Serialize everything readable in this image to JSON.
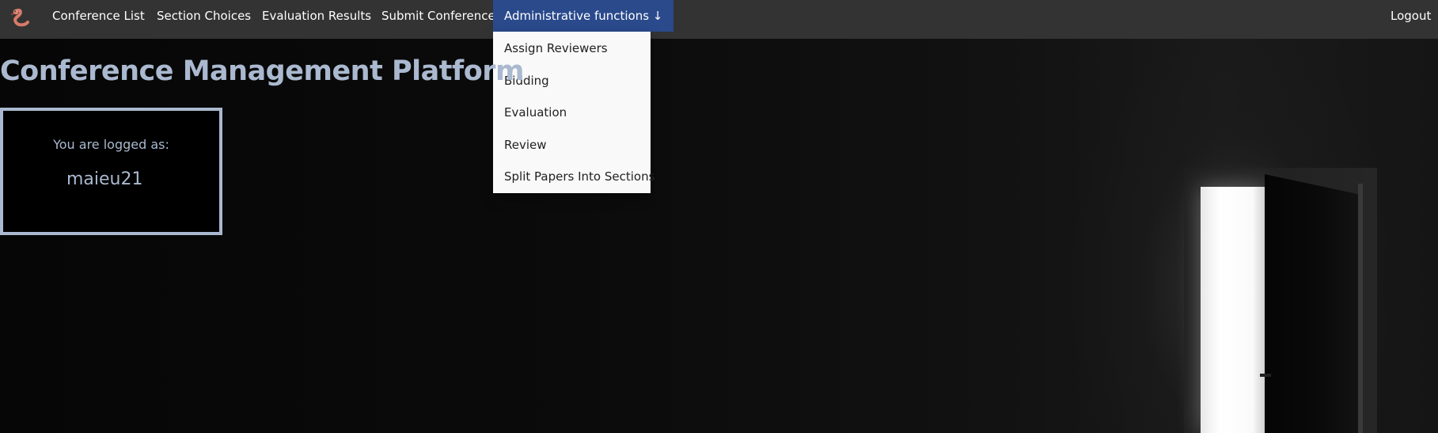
{
  "navbar": {
    "logo_icon": "worm-logo-icon",
    "items": [
      {
        "label": "Conference List"
      },
      {
        "label": "Section Choices"
      },
      {
        "label": "Evaluation Results"
      },
      {
        "label": "Submit Conference"
      }
    ],
    "admin_menu": {
      "label": "Administrative functions ↓",
      "active_color": "#2a4a8c",
      "items": [
        {
          "label": "Assign Reviewers"
        },
        {
          "label": "Bidding"
        },
        {
          "label": "Evaluation"
        },
        {
          "label": "Review"
        },
        {
          "label": "Split Papers Into Sections"
        }
      ]
    },
    "logout_label": "Logout"
  },
  "main": {
    "title": "Conference Management Platform",
    "login_box": {
      "label": "You are logged as:",
      "username": "maieu21"
    }
  },
  "colors": {
    "navbar_bg": "#333333",
    "accent_text": "#aab9cf",
    "dropdown_bg": "#f9f9f9"
  }
}
